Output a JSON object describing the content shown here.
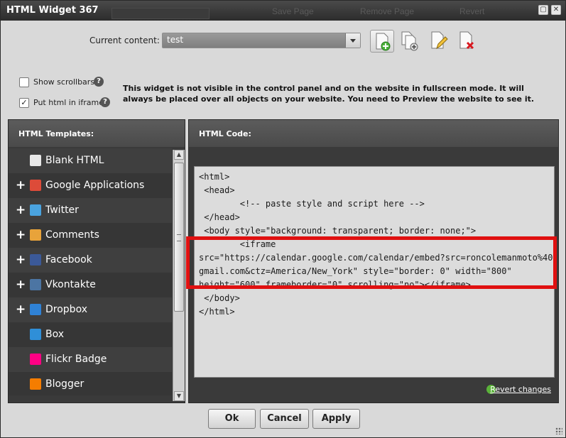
{
  "window": {
    "title": "HTML Widget 367",
    "bg_ghost_items": [
      "Save Page",
      "Remove Page",
      "Revert"
    ]
  },
  "content": {
    "label": "Current content:",
    "selected": "test"
  },
  "toolbar": {
    "icons": [
      "add-page-icon",
      "duplicate-page-icon",
      "edit-page-icon",
      "delete-page-icon"
    ]
  },
  "options": {
    "show_scrollbars": {
      "label": "Show scrollbars",
      "checked": false
    },
    "put_in_iframe": {
      "label": "Put html in iframe",
      "checked": true
    },
    "notice": "This widget is not visible in the control panel and on the website in fullscreen mode. It will always be placed over all objects on your website. You need to Preview the website to see it."
  },
  "templates": {
    "header": "HTML Templates:",
    "items": [
      {
        "name": "Blank HTML",
        "expandable": false,
        "icon": "html-file-icon",
        "icon_color": "#e8e8e8"
      },
      {
        "name": "Google Applications",
        "expandable": true,
        "icon": "google-icon",
        "icon_color": "#dd4b39"
      },
      {
        "name": "Twitter",
        "expandable": true,
        "icon": "twitter-icon",
        "icon_color": "#4aa3df"
      },
      {
        "name": "Comments",
        "expandable": true,
        "icon": "comments-icon",
        "icon_color": "#e8a33a"
      },
      {
        "name": "Facebook",
        "expandable": true,
        "icon": "facebook-icon",
        "icon_color": "#3b5998"
      },
      {
        "name": "Vkontakte",
        "expandable": true,
        "icon": "vkontakte-icon",
        "icon_color": "#4c75a3"
      },
      {
        "name": "Dropbox",
        "expandable": true,
        "icon": "dropbox-icon",
        "icon_color": "#2f82d6"
      },
      {
        "name": "Box",
        "expandable": false,
        "icon": "box-icon",
        "icon_color": "#2f8fd8"
      },
      {
        "name": "Flickr Badge",
        "expandable": false,
        "icon": "flickr-icon",
        "icon_color": "#ff0084"
      },
      {
        "name": "Blogger",
        "expandable": false,
        "icon": "blogger-icon",
        "icon_color": "#f57d00"
      }
    ]
  },
  "code": {
    "header": "HTML Code:",
    "text": "<html>\n <head>\n        <!-- paste style and script here -->\n </head>\n <body style=\"background: transparent; border: none;\">\n        <iframe\nsrc=\"https://calendar.google.com/calendar/embed?src=roncolemanmoto%40\ngmail.com&ctz=America/New_York\" style=\"border: 0\" width=\"800\"\nheight=\"600\" frameborder=\"0\" scrolling=\"no\"></iframe>\n </body>\n</html>",
    "revert_label": "Revert changes"
  },
  "buttons": {
    "ok": "Ok",
    "cancel": "Cancel",
    "apply": "Apply"
  }
}
